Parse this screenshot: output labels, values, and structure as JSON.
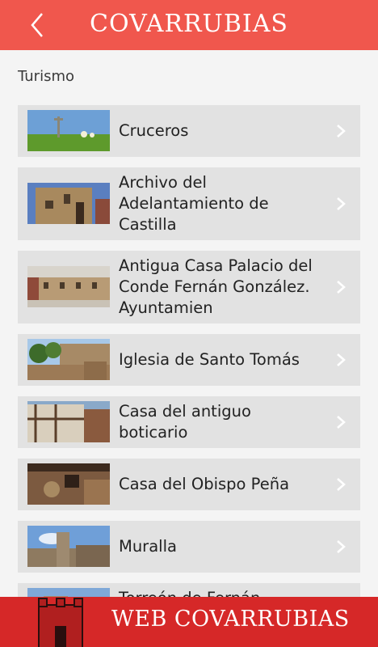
{
  "header": {
    "title": "COVARRUBIAS"
  },
  "section": {
    "title": "Turismo"
  },
  "items": [
    {
      "label": "Cruceros"
    },
    {
      "label": "Archivo del Adelantamiento de Castilla"
    },
    {
      "label": "Antigua Casa Palacio del Conde Fernán González. Ayuntamien"
    },
    {
      "label": "Iglesia de Santo Tomás"
    },
    {
      "label": "Casa del antiguo boticario"
    },
    {
      "label": "Casa del Obispo Peña"
    },
    {
      "label": "Muralla"
    },
    {
      "label": "Torreón de Fernán González"
    }
  ],
  "footer": {
    "text": "WEB COVARRUBIAS"
  },
  "colors": {
    "header": "#f0574d",
    "footer": "#d62828",
    "item_bg": "#e2e2e2"
  }
}
